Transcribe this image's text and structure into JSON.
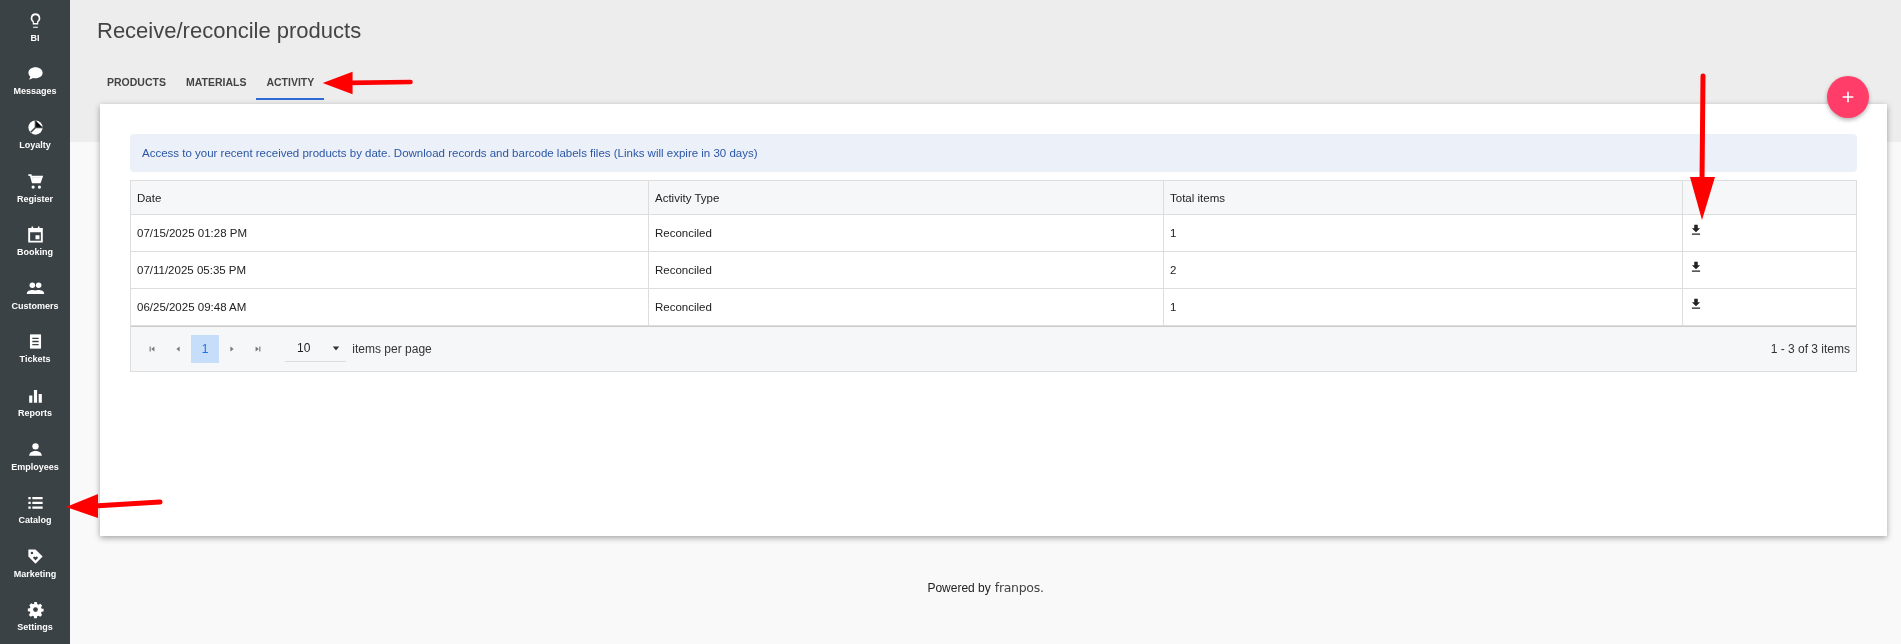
{
  "sidebar": {
    "items": [
      {
        "label": "BI"
      },
      {
        "label": "Messages"
      },
      {
        "label": "Loyalty"
      },
      {
        "label": "Register"
      },
      {
        "label": "Booking"
      },
      {
        "label": "Customers"
      },
      {
        "label": "Tickets"
      },
      {
        "label": "Reports"
      },
      {
        "label": "Employees"
      },
      {
        "label": "Catalog"
      },
      {
        "label": "Marketing"
      },
      {
        "label": "Settings"
      }
    ]
  },
  "page": {
    "title": "Receive/reconcile products"
  },
  "tabs": [
    {
      "label": "PRODUCTS",
      "selected": false
    },
    {
      "label": "MATERIALS",
      "selected": false
    },
    {
      "label": "ACTIVITY",
      "selected": true
    }
  ],
  "info": "Access to your recent received products by date. Download records and barcode labels files (Links will expire in 30 days)",
  "table": {
    "columns": [
      "Date",
      "Activity Type",
      "Total items"
    ],
    "rows": [
      {
        "date": "07/15/2025 01:28 PM",
        "activity_type": "Reconciled",
        "total_items": "1"
      },
      {
        "date": "07/11/2025 05:35 PM",
        "activity_type": "Reconciled",
        "total_items": "2"
      },
      {
        "date": "06/25/2025 09:48 AM",
        "activity_type": "Reconciled",
        "total_items": "1"
      }
    ]
  },
  "pager": {
    "pages": [
      {
        "label": "1",
        "selected": true
      }
    ],
    "page_size": "10",
    "page_size_label": "items per page",
    "summary": "1 - 3 of 3 items"
  },
  "footer": {
    "text": "Powered by",
    "brand": "franpos."
  }
}
